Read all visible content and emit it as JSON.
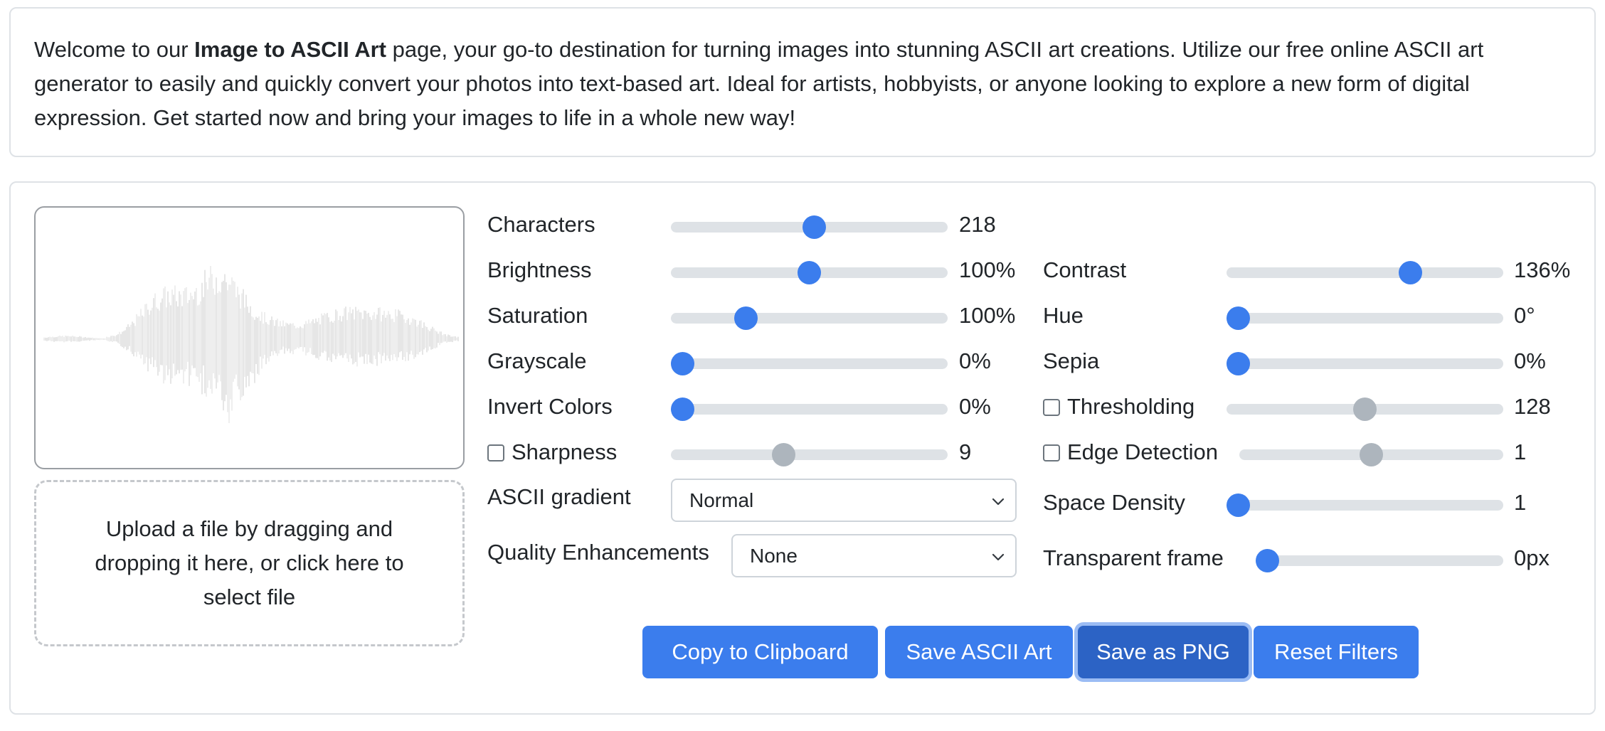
{
  "intro": {
    "text_before": "Welcome to our ",
    "bold": "Image to ASCII Art",
    "text_after": " page, your go-to destination for turning images into stunning ASCII art creations. Utilize our free online ASCII art generator to easily and quickly convert your photos into text-based art. Ideal for artists, hobbyists, or anyone looking to explore a new form of digital expression. Get started now and bring your images to life in a whole new way!"
  },
  "dropzone": {
    "text": "Upload a file by dragging and dropping it here, or click here to select file"
  },
  "controls": {
    "characters": {
      "label": "Characters",
      "value": "218",
      "fraction": 0.52
    },
    "brightness": {
      "label": "Brightness",
      "value": "100%",
      "fraction": 0.5
    },
    "contrast": {
      "label": "Contrast",
      "value": "136%",
      "fraction": 0.68
    },
    "saturation": {
      "label": "Saturation",
      "value": "100%",
      "fraction": 0.25
    },
    "hue": {
      "label": "Hue",
      "value": "0°",
      "fraction": 0.0
    },
    "grayscale": {
      "label": "Grayscale",
      "value": "0%",
      "fraction": 0.0
    },
    "sepia": {
      "label": "Sepia",
      "value": "0%",
      "fraction": 0.0
    },
    "invert": {
      "label": "Invert Colors",
      "value": "0%",
      "fraction": 0.0
    },
    "thresholding": {
      "label": "Thresholding",
      "value": "128",
      "fraction": 0.5,
      "checked": false
    },
    "sharpness": {
      "label": "Sharpness",
      "value": "9",
      "fraction": 0.4,
      "checked": false
    },
    "edge": {
      "label": "Edge Detection",
      "value": "1",
      "fraction": 0.5,
      "checked": false
    },
    "space_density": {
      "label": "Space Density",
      "value": "1",
      "fraction": 0.0
    },
    "transparent_frame": {
      "label": "Transparent frame",
      "value": "0px",
      "fraction": 0.0
    }
  },
  "ascii_gradient": {
    "label": "ASCII gradient",
    "selected": "Normal"
  },
  "quality": {
    "label": "Quality Enhancements",
    "selected": "None"
  },
  "buttons": {
    "copy": "Copy to Clipboard",
    "save_ascii": "Save ASCII Art",
    "save_png": "Save as PNG",
    "reset": "Reset Filters"
  },
  "colors": {
    "accent": "#3b7ded",
    "accent_active": "#2c63c5",
    "disabled_thumb": "#adb5bd",
    "track": "#dee2e6"
  },
  "icons": {
    "select_arrow": "chevron-down-icon"
  }
}
